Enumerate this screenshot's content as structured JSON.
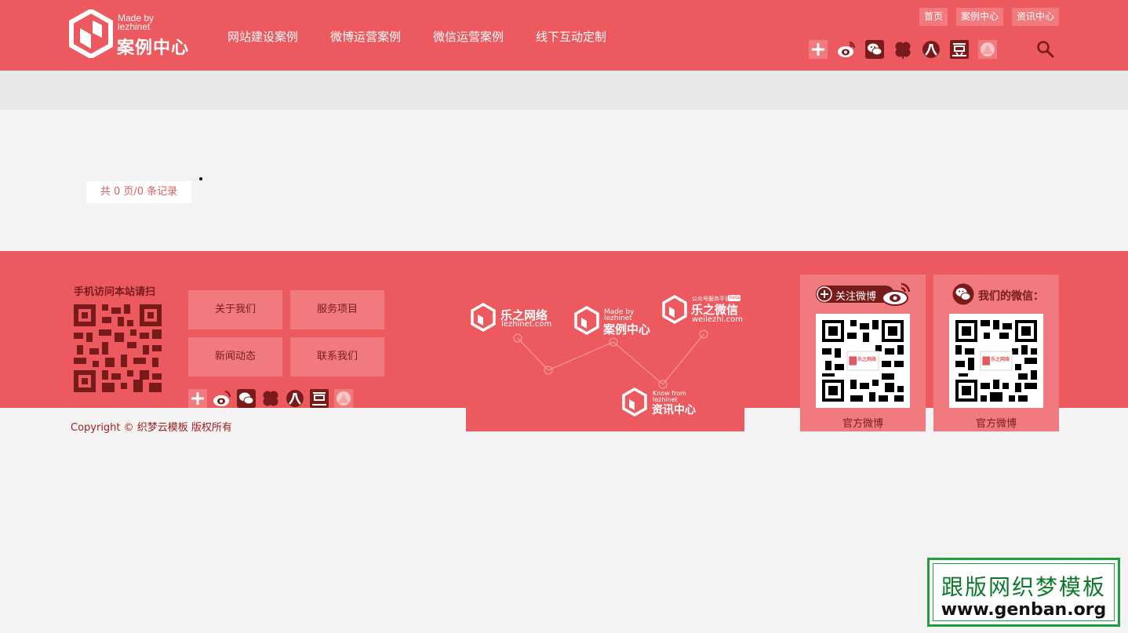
{
  "header": {
    "logo": {
      "made_by": "Made by",
      "made_by_2": "lezhinet",
      "title": "案例中心"
    },
    "nav": [
      "网站建设案例",
      "微博运营案例",
      "微信运营案例",
      "线下互动定制"
    ],
    "top_links": [
      "首页",
      "案例中心",
      "资讯中心"
    ],
    "social_icons": [
      "add-icon",
      "weibo-icon",
      "wechat-icon",
      "clover-icon",
      "renren-icon",
      "douban-icon",
      "circle-icon"
    ]
  },
  "main": {
    "pagination": "共 0 页/0 条记录"
  },
  "footer": {
    "mobile_label": "手机访问本站请扫",
    "buttons": [
      "关于我们",
      "服务项目",
      "新闻动态",
      "联系我们"
    ],
    "brands": {
      "b1_title": "乐之网络",
      "b1_sub": "lezhinet.com",
      "b2_made": "Made by",
      "b2_made_2": "lezhinet",
      "b2_title": "案例中心",
      "b3_top": "公众号服务平台",
      "b3_badge": "beta",
      "b3_title": "乐之微信",
      "b3_sub": "weilezhi.com",
      "b4_small": "Know from",
      "b4_small_2": "lezhinet",
      "b4_title": "资讯中心"
    },
    "weibo_card": {
      "title": "关注微博",
      "caption": "官方微博"
    },
    "wechat_card": {
      "title": "我们的微信：",
      "caption": "官方微博"
    },
    "qr_logo_text": "乐之网络",
    "copyright": "Copyright © 织梦云模板 版权所有"
  },
  "watermark": {
    "line1": "跟版网织梦模板",
    "line2": "www.genban.org"
  },
  "colors": {
    "brand": "#ec5a60",
    "light": "#f07a7e",
    "dark_text": "#7a1b1b",
    "watermark_green": "#1f9e3d"
  }
}
